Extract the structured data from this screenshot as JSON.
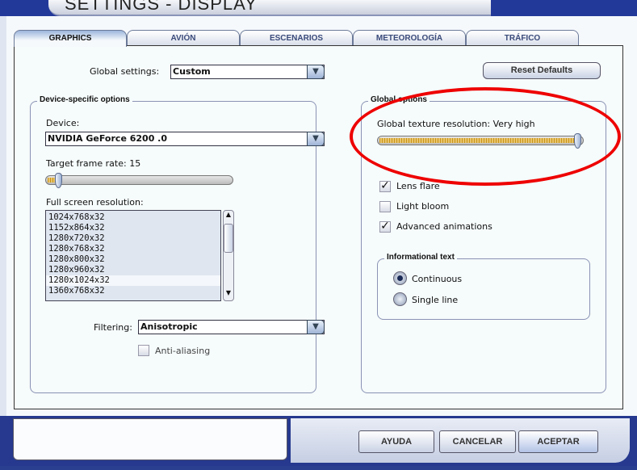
{
  "window": {
    "title": "SETTINGS - DISPLAY"
  },
  "tabs": [
    {
      "label": "GRAPHICS",
      "active": true
    },
    {
      "label": "AVIÓN"
    },
    {
      "label": "ESCENARIOS"
    },
    {
      "label": "METEOROLOGÍA"
    },
    {
      "label": "TRÁFICO"
    }
  ],
  "global_settings": {
    "label": "Global settings:",
    "value": "Custom"
  },
  "reset_label": "Reset Defaults",
  "device_group": {
    "title": "Device-specific options",
    "device_label": "Device:",
    "device_value": "NVIDIA GeForce 6200  .0",
    "frame_rate_label": "Target frame rate: 15",
    "frame_rate_fraction": 0.05,
    "resolution_label": "Full screen resolution:",
    "resolutions": [
      "1024x768x32",
      "1152x864x32",
      "1280x720x32",
      "1280x768x32",
      "1280x800x32",
      "1280x960x32",
      "1280x1024x32",
      "1360x768x32"
    ],
    "selected_resolution": "1280x1024x32",
    "filtering_label": "Filtering:",
    "filtering_value": "Anisotropic",
    "anti_aliasing_label": "Anti-aliasing",
    "anti_aliasing": false
  },
  "global_group": {
    "title": "Global options",
    "texture_label": "Global texture resolution: Very high",
    "texture_fraction": 1.0,
    "lens_flare": {
      "label": "Lens flare",
      "checked": true
    },
    "light_bloom": {
      "label": "Light bloom",
      "checked": false
    },
    "advanced_animations": {
      "label": "Advanced animations",
      "checked": true
    },
    "info_text": {
      "title": "Informational text",
      "options": [
        "Continuous",
        "Single line"
      ],
      "selected": "Continuous"
    }
  },
  "buttons": {
    "help": "AYUDA",
    "cancel": "CANCELAR",
    "ok": "ACEPTAR"
  },
  "colors": {
    "annotation": "#e00000",
    "frame": "#26398f"
  }
}
